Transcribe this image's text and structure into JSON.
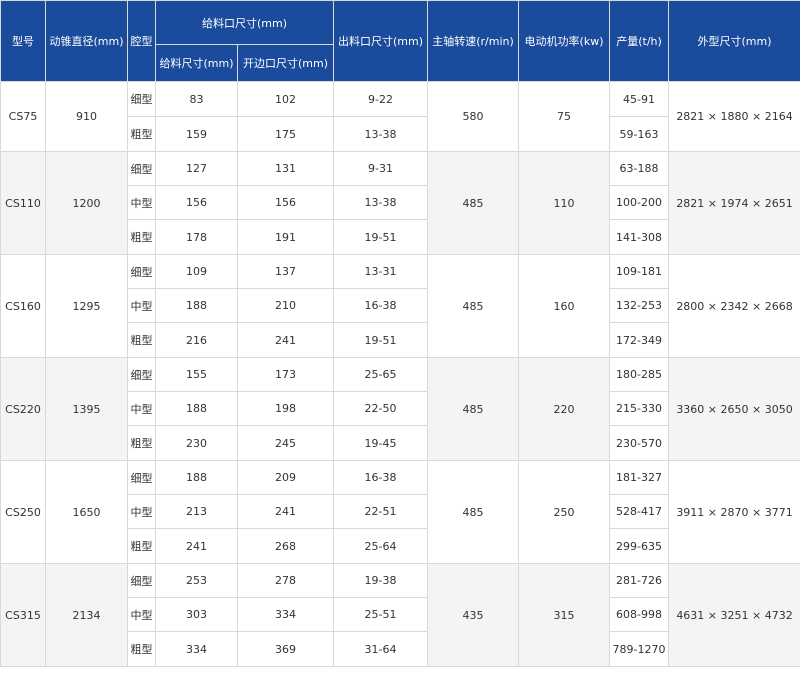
{
  "headers": {
    "model": "型号",
    "cone_diameter": "动锥直径(mm)",
    "cavity": "腔型",
    "feed_size_group": "给料口尺寸(mm)",
    "feed_size": "给料尺寸(mm)",
    "open_side": "开边口尺寸(mm)",
    "discharge": "出料口尺寸(mm)",
    "spindle_speed": "主轴转速(r/min)",
    "motor_power": "电动机功率(kw)",
    "capacity": "产量(t/h)",
    "dimensions": "外型尺寸(mm)"
  },
  "models": [
    {
      "model": "CS75",
      "diameter": "910",
      "speed": "580",
      "power": "75",
      "dims": "2821 × 1880 × 2164",
      "rows": [
        {
          "cavity": "细型",
          "feed": "83",
          "open": "102",
          "discharge": "9-22",
          "capacity": "45-91"
        },
        {
          "cavity": "粗型",
          "feed": "159",
          "open": "175",
          "discharge": "13-38",
          "capacity": "59-163"
        }
      ]
    },
    {
      "model": "CS110",
      "diameter": "1200",
      "speed": "485",
      "power": "110",
      "dims": "2821 × 1974 × 2651",
      "rows": [
        {
          "cavity": "细型",
          "feed": "127",
          "open": "131",
          "discharge": "9-31",
          "capacity": "63-188"
        },
        {
          "cavity": "中型",
          "feed": "156",
          "open": "156",
          "discharge": "13-38",
          "capacity": "100-200"
        },
        {
          "cavity": "粗型",
          "feed": "178",
          "open": "191",
          "discharge": "19-51",
          "capacity": "141-308"
        }
      ]
    },
    {
      "model": "CS160",
      "diameter": "1295",
      "speed": "485",
      "power": "160",
      "dims": "2800 × 2342 × 2668",
      "rows": [
        {
          "cavity": "细型",
          "feed": "109",
          "open": "137",
          "discharge": "13-31",
          "capacity": "109-181"
        },
        {
          "cavity": "中型",
          "feed": "188",
          "open": "210",
          "discharge": "16-38",
          "capacity": "132-253"
        },
        {
          "cavity": "粗型",
          "feed": "216",
          "open": "241",
          "discharge": "19-51",
          "capacity": "172-349"
        }
      ]
    },
    {
      "model": "CS220",
      "diameter": "1395",
      "speed": "485",
      "power": "220",
      "dims": "3360 × 2650 × 3050",
      "rows": [
        {
          "cavity": "细型",
          "feed": "155",
          "open": "173",
          "discharge": "25-65",
          "capacity": "180-285"
        },
        {
          "cavity": "中型",
          "feed": "188",
          "open": "198",
          "discharge": "22-50",
          "capacity": "215-330"
        },
        {
          "cavity": "粗型",
          "feed": "230",
          "open": "245",
          "discharge": "19-45",
          "capacity": "230-570"
        }
      ]
    },
    {
      "model": "CS250",
      "diameter": "1650",
      "speed": "485",
      "power": "250",
      "dims": "3911 × 2870 × 3771",
      "rows": [
        {
          "cavity": "细型",
          "feed": "188",
          "open": "209",
          "discharge": "16-38",
          "capacity": "181-327"
        },
        {
          "cavity": "中型",
          "feed": "213",
          "open": "241",
          "discharge": "22-51",
          "capacity": "528-417"
        },
        {
          "cavity": "粗型",
          "feed": "241",
          "open": "268",
          "discharge": "25-64",
          "capacity": "299-635"
        }
      ]
    },
    {
      "model": "CS315",
      "diameter": "2134",
      "speed": "435",
      "power": "315",
      "dims": "4631 × 3251 × 4732",
      "rows": [
        {
          "cavity": "细型",
          "feed": "253",
          "open": "278",
          "discharge": "19-38",
          "capacity": "281-726"
        },
        {
          "cavity": "中型",
          "feed": "303",
          "open": "334",
          "discharge": "25-51",
          "capacity": "608-998"
        },
        {
          "cavity": "粗型",
          "feed": "334",
          "open": "369",
          "discharge": "31-64",
          "capacity": "789-1270"
        }
      ]
    }
  ]
}
